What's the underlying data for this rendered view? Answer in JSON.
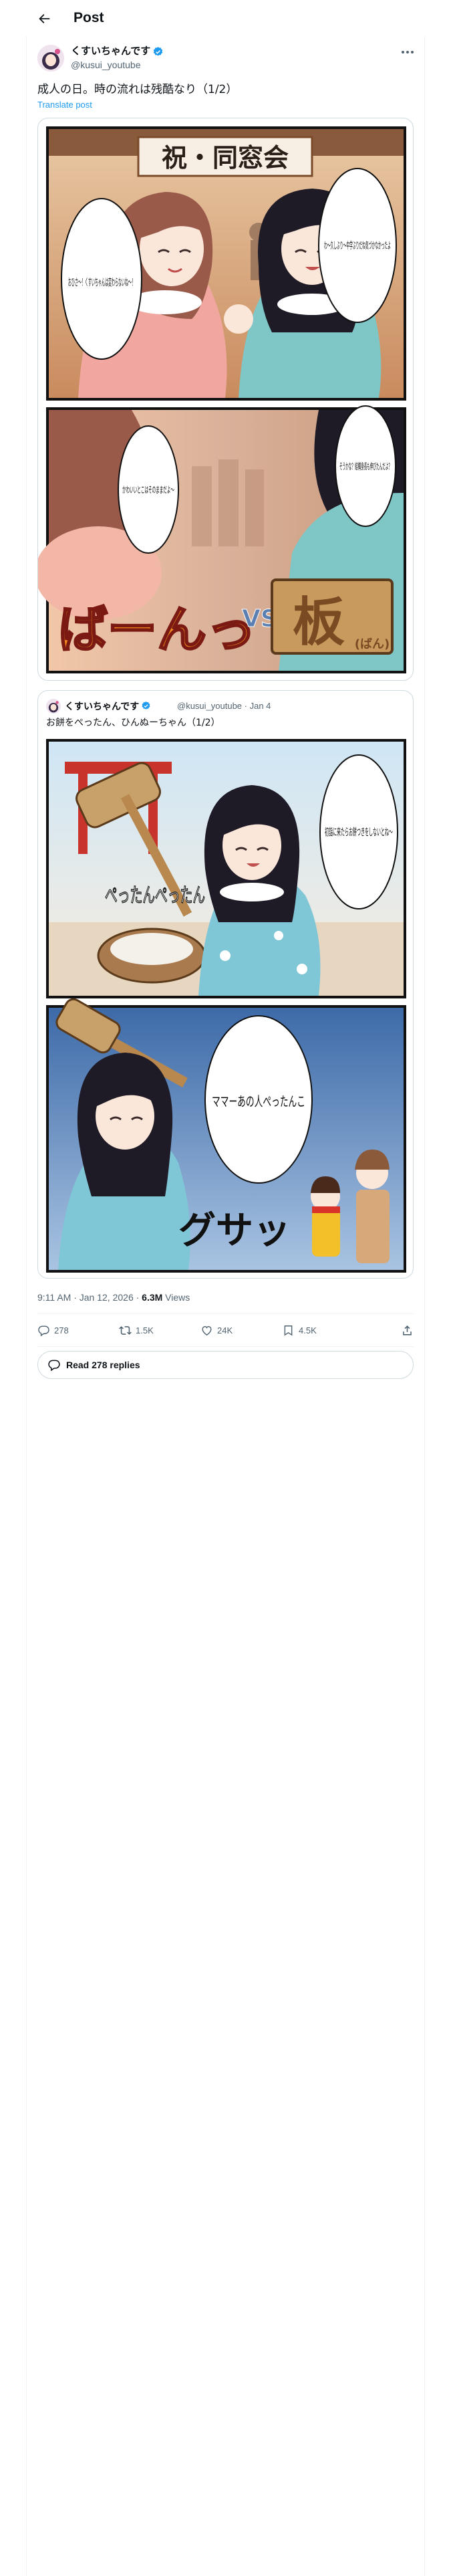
{
  "header": {
    "title": "Post"
  },
  "post": {
    "author_name": "くすいちゃんです",
    "author_handle": "@kusui_youtube",
    "text": "成人の日。時の流れは残酷なり（1/2）",
    "translate_label": "Translate post",
    "comic_top": {
      "sign": "祝・同窓会",
      "bubble_right": "わ〜久しぶり〜中学ぶりだね気づかなかったよ",
      "bubble_left": "おひさ〜！くすいちゃんは変わらないね〜！",
      "bubble_right_2": "そうかな？結構身長も伸びたんだよ？",
      "bubble_left_2": "かわいいとこはそのままだよ〜",
      "sfx_left": "ばーんっ",
      "vs": "VS",
      "sfx_right": "板",
      "sfx_right_ruby": "(ばん)"
    },
    "quoted": {
      "author_name": "くすいちゃんです",
      "author_handle": "@kusui_youtube · Jan 4",
      "text": "お餅をぺったん、ひんぬーちゃん（1/2）",
      "panel1_bubble": "初詣に来たらお餅つきをしないとね〜",
      "panel1_sfx": "ぺったんぺったん",
      "panel2_bubble": "ママーあの人ぺったんこ",
      "panel2_sfx": "グサッ"
    },
    "timestamp": "9:11 AM · Jan 12, 2026 · ",
    "views_count": "6.3M",
    "views_label": " Views",
    "actions": {
      "replies": "278",
      "reposts": "1.5K",
      "likes": "24K",
      "bookmarks": "4.5K"
    },
    "read_replies_label": "Read 278 replies"
  },
  "colors": {
    "accent": "#1d9bf0",
    "text": "#0f1419",
    "muted": "#536471",
    "border": "#cfd9de"
  }
}
